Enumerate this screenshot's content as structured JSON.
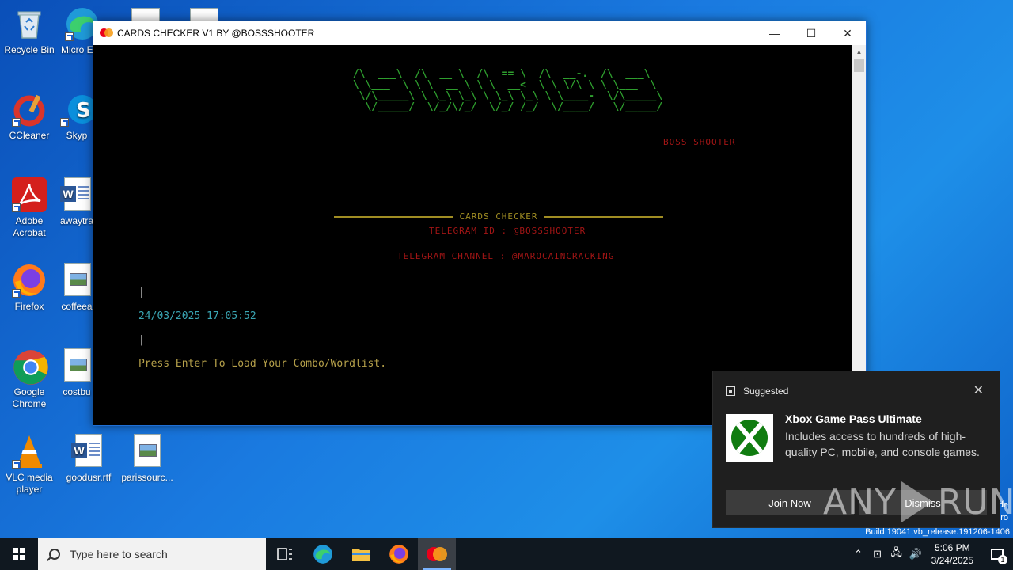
{
  "desktop": {
    "icons": [
      {
        "label": "Recycle Bin",
        "icon": "recycle-bin-icon"
      },
      {
        "label": "Micro Edg",
        "icon": "edge-icon"
      },
      {
        "label": "CCleaner",
        "icon": "ccleaner-icon"
      },
      {
        "label": "Skyp",
        "icon": "skype-icon"
      },
      {
        "label": "Adobe Acrobat",
        "icon": "acrobat-icon"
      },
      {
        "label": "awaytra",
        "icon": "word-doc-icon"
      },
      {
        "label": "Firefox",
        "icon": "firefox-icon"
      },
      {
        "label": "coffeea",
        "icon": "image-file-icon"
      },
      {
        "label": "Google Chrome",
        "icon": "chrome-icon"
      },
      {
        "label": "costbu",
        "icon": "image-file-icon"
      },
      {
        "label": "VLC media player",
        "icon": "vlc-icon"
      },
      {
        "label": "goodusr.rtf",
        "icon": "word-doc-icon"
      },
      {
        "label": "parissourc...",
        "icon": "image-file-icon"
      }
    ]
  },
  "window": {
    "title": "CARDS CHECKER V1 BY @BOSSSHOOTER",
    "minimize": "—",
    "maximize": "☐",
    "close": "✕"
  },
  "console": {
    "banner": " /\\  ___\\  /\\  __ \\  /\\  == \\  /\\  __-.  /\\  ___\\\n \\ \\___  \\ \\ \\  __ \\ \\ \\  __<  \\ \\ \\/\\ \\ \\ \\___  \\\n  \\/\\_____\\ \\ \\_\\ \\_\\ \\ \\_\\ \\_\\ \\ \\____-  \\/\\_____\\\n   \\/_____/  \\/_/\\/_/  \\/_/ /_/  \\/____/   \\/_____/",
    "author": "BOSS SHOOTER",
    "section_title": "CARDS CHECKER",
    "telegram_id": "TELEGRAM ID : @BOSSSHOOTER",
    "telegram_channel": "TELEGRAM CHANNEL : @MAROCAINCRACKING",
    "prompt_sep_left": "|",
    "prompt_timestamp": "24/03/2025 17:05:52",
    "prompt_sep_right": "|",
    "prompt_message": "Press Enter To Load Your Combo/Wordlist."
  },
  "toast": {
    "header": "Suggested",
    "app_name": "Xbox Game Pass Ultimate",
    "body": "Includes access to hundreds of high-quality PC, mobile, and console games.",
    "join_label": "Join Now",
    "dismiss_label": "Dismiss"
  },
  "watermark": {
    "left": "ANY",
    "right": "RUN"
  },
  "edge_text": {
    "line1": "de",
    "line2": "ro",
    "build": "Build 19041.vb_release.191206-1406"
  },
  "taskbar": {
    "search_placeholder": "Type here to search",
    "time": "5:06 PM",
    "date": "3/24/2025",
    "notification_count": "1"
  }
}
